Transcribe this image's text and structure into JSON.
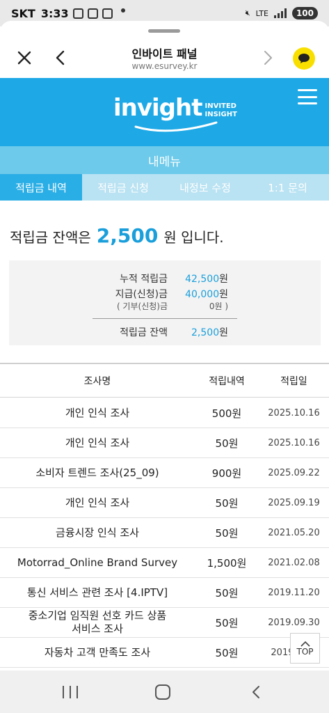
{
  "status": {
    "carrier": "SKT",
    "time": "3:33",
    "network": "LTE",
    "battery": "100"
  },
  "browser": {
    "title": "인바이트 패널",
    "url": "www.esurvey.kr"
  },
  "header": {
    "logo_word": "invight",
    "logo_sub_1": "INVITED",
    "logo_sub_2": "INSIGHT"
  },
  "menu": {
    "title": "내메뉴",
    "tabs": [
      {
        "label": "적립금 내역"
      },
      {
        "label": "적립금 신청"
      },
      {
        "label": "내정보 수정"
      },
      {
        "label": "1:1 문의"
      }
    ]
  },
  "balance": {
    "prefix": "적립금 잔액은",
    "amount": "2,500",
    "suffix": "원 입니다."
  },
  "summary": {
    "cumulative_label": "누적 적립금",
    "cumulative_value": "42,500",
    "paid_label": "지급(신청)금",
    "paid_value": "40,000",
    "donation_label": "( 기부(신청)금",
    "donation_value": "0원 )",
    "balance_label": "적립금 잔액",
    "balance_value": "2,500",
    "won": "원"
  },
  "table": {
    "headers": {
      "name": "조사명",
      "amount": "적립내역",
      "date": "적립일"
    },
    "rows": [
      {
        "name": "개인 인식 조사",
        "amount": "500원",
        "date": "2025.10.16"
      },
      {
        "name": "개인 인식 조사",
        "amount": "50원",
        "date": "2025.10.16"
      },
      {
        "name": "소비자 트렌드 조사(25_09)",
        "amount": "900원",
        "date": "2025.09.22"
      },
      {
        "name": "개인 인식 조사",
        "amount": "50원",
        "date": "2025.09.19"
      },
      {
        "name": "금융시장 인식 조사",
        "amount": "50원",
        "date": "2021.05.20"
      },
      {
        "name": "Motorrad_Online Brand Survey",
        "amount": "1,500원",
        "date": "2021.02.08"
      },
      {
        "name": "통신 서비스 관련 조사 [4.IPTV]",
        "amount": "50원",
        "date": "2019.11.20"
      },
      {
        "name_line1": "중소기업 임직원 선호 카드 상품",
        "name_line2": "서비스 조사",
        "amount": "50원",
        "date": "2019.09.30"
      },
      {
        "name": "자동차 고객 만족도 조사",
        "amount": "50원",
        "date": "2019.07.0"
      }
    ]
  },
  "top_button": {
    "label": "TOP"
  },
  "colors": {
    "brand_blue": "#1ea9e6",
    "menu_bar": "#6dcaea",
    "tab_bar": "#b9e2f2",
    "amount_blue": "#1a9fdb",
    "kakao_yellow": "#f9df00"
  }
}
